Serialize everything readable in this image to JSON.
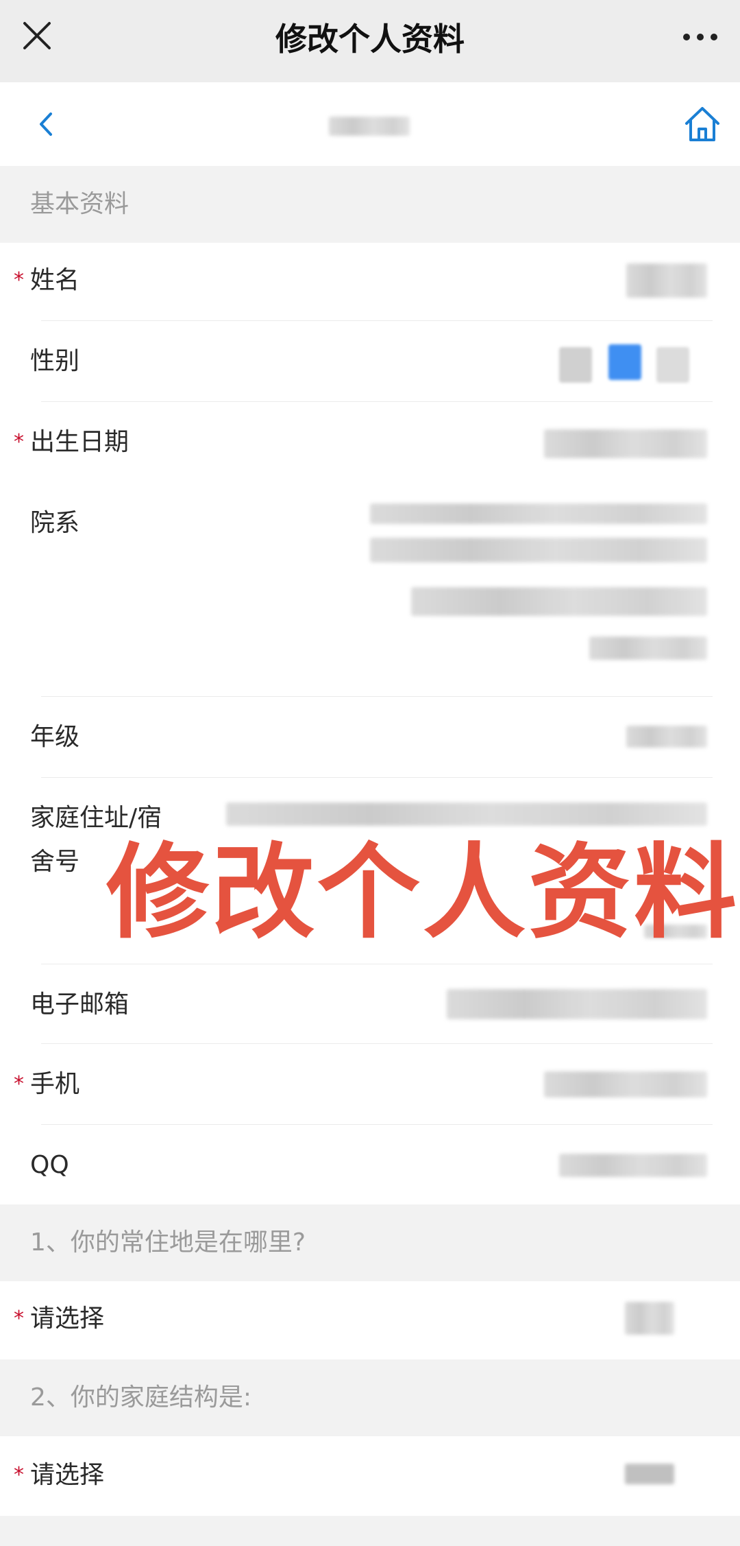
{
  "window": {
    "title": "修改个人资料",
    "close_icon": "close-icon",
    "more_icon": "more-icon"
  },
  "nav": {
    "back_icon": "chevron-left-icon",
    "home_icon": "home-icon"
  },
  "sections": {
    "basic": "基本资料",
    "q1": "1、你的常住地是在哪里?",
    "q2": "2、你的家庭结构是:"
  },
  "fields": {
    "name": {
      "label": "姓名",
      "required": "*"
    },
    "gender": {
      "label": "性别"
    },
    "birthdate": {
      "label": "出生日期",
      "required": "*"
    },
    "department": {
      "label": "院系"
    },
    "grade": {
      "label": "年级"
    },
    "address": {
      "label_line1": "家庭住址/宿",
      "label_line2": "舍号"
    },
    "email": {
      "label": "电子邮箱"
    },
    "phone": {
      "label": "手机",
      "required": "*"
    },
    "qq": {
      "label": "QQ"
    },
    "residence": {
      "label": "请选择",
      "required": "*"
    },
    "family": {
      "label": "请选择",
      "required": "*"
    }
  },
  "overlay": {
    "watermark": "修改个人资料"
  },
  "colors": {
    "required_mark": "#c8102e",
    "accent": "#1a7fd4",
    "watermark": "#e5533f"
  }
}
